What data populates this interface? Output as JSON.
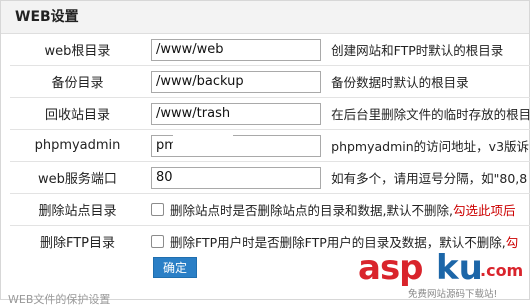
{
  "panel": {
    "title": "WEB设置"
  },
  "rows": [
    {
      "label": "web根目录",
      "value": "/www/web",
      "hint": "创建网站和FTP时默认的根目录"
    },
    {
      "label": "备份目录",
      "value": "/www/backup",
      "hint": "备份数据时默认的根目录"
    },
    {
      "label": "回收站目录",
      "value": "/www/trash",
      "hint": "在后台里删除文件的临时存放的根目"
    },
    {
      "label": "phpmyadmin",
      "value": "pm",
      "hint": "phpmyadmin的访问地址，v3版诉"
    },
    {
      "label": "web服务端口",
      "value": "80",
      "hint_pre": "如有多个，请用逗号分隔，如\"80,8"
    }
  ],
  "checkbox_rows": [
    {
      "label": "删除站点目录",
      "text": "删除站点时是否删除站点的目录和数据,默认不删除,",
      "text_red": "勾选此项后"
    },
    {
      "label": "删除FTP目录",
      "text": "删除FTP用户时是否删除FTP用户的目录及数据，默认不删除,",
      "text_red": "勾"
    }
  ],
  "buttons": {
    "ok_label": "确定"
  },
  "footer": {
    "text": "WEB文件的保护设置"
  },
  "watermark": {
    "main_a": "asp",
    "main_b": "ku",
    "tld": ".com",
    "sub": "免费网站源码下载站!"
  },
  "colors": {
    "accent": "#2a7fc6",
    "warning": "#cc0000",
    "brand_red": "#d9242c",
    "brand_blue": "#1c66a8"
  },
  "checkbox_states": [
    false,
    false
  ]
}
